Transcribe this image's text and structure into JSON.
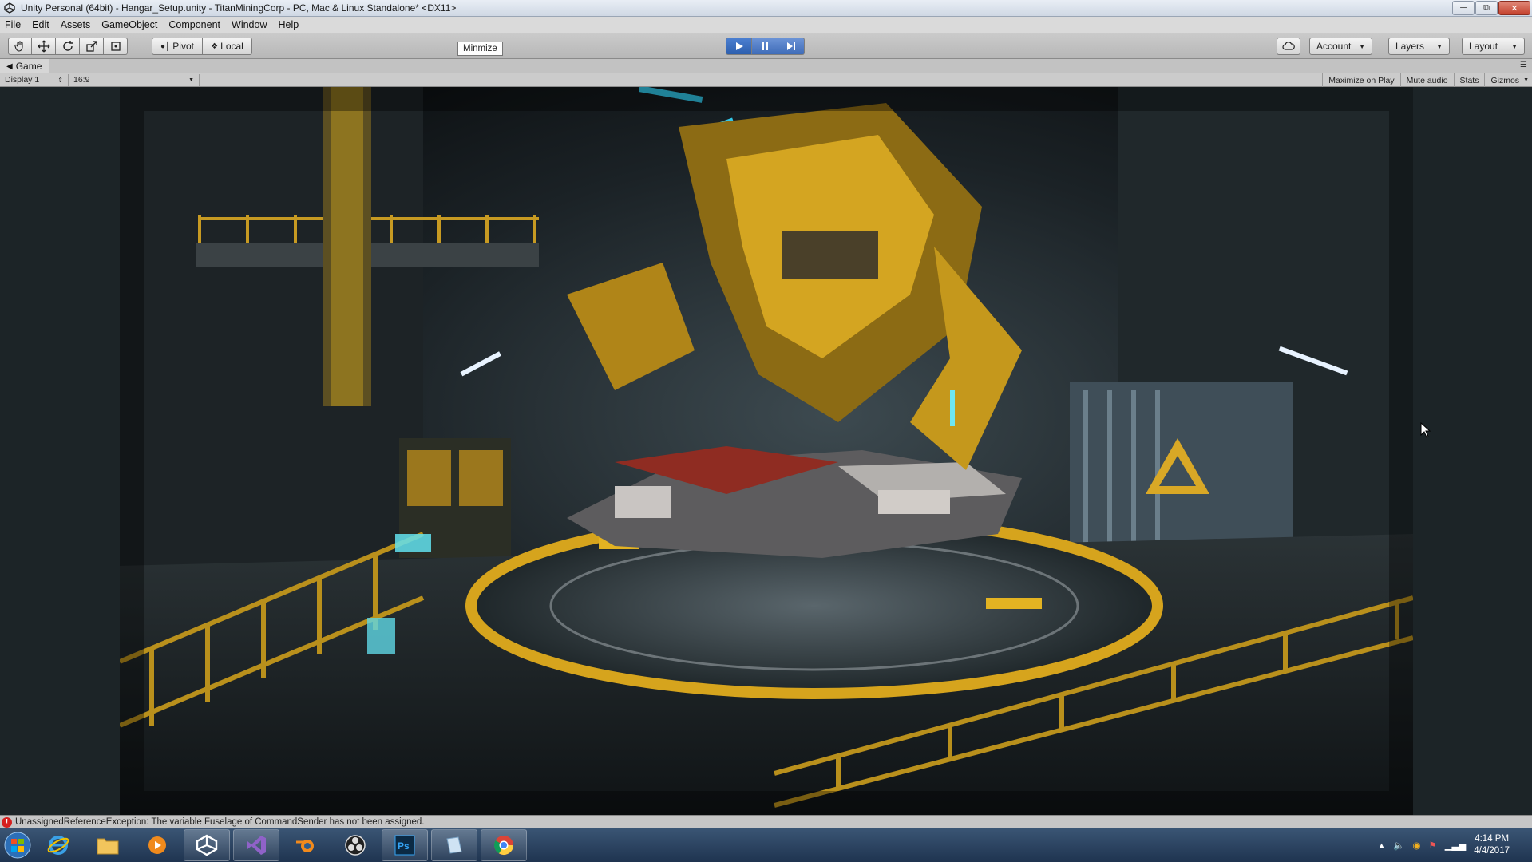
{
  "window": {
    "title": "Unity Personal (64bit) - Hangar_Setup.unity - TitanMiningCorp - PC, Mac & Linux Standalone* <DX11>",
    "minimize_tooltip": "Minmize"
  },
  "menu": [
    "File",
    "Edit",
    "Assets",
    "GameObject",
    "Component",
    "Window",
    "Help"
  ],
  "toolbar": {
    "pivot_label": "Pivot",
    "local_label": "Local",
    "account_label": "Account",
    "layers_label": "Layers",
    "layout_label": "Layout"
  },
  "game_panel": {
    "tab_label": "Game",
    "display_label": "Display 1",
    "aspect_label": "16:9",
    "maximize_on_play": "Maximize on Play",
    "mute_audio": "Mute audio",
    "stats": "Stats",
    "gizmos": "Gizmos"
  },
  "console": {
    "error_message": "UnassignedReferenceException: The variable Fuselage of CommandSender has not been assigned."
  },
  "taskbar": {
    "time": "4:14 PM",
    "date": "4/4/2017"
  },
  "colors": {
    "play_active": "#2d5fae",
    "error": "#d6201f",
    "accent_yellow": "#e6b020"
  }
}
